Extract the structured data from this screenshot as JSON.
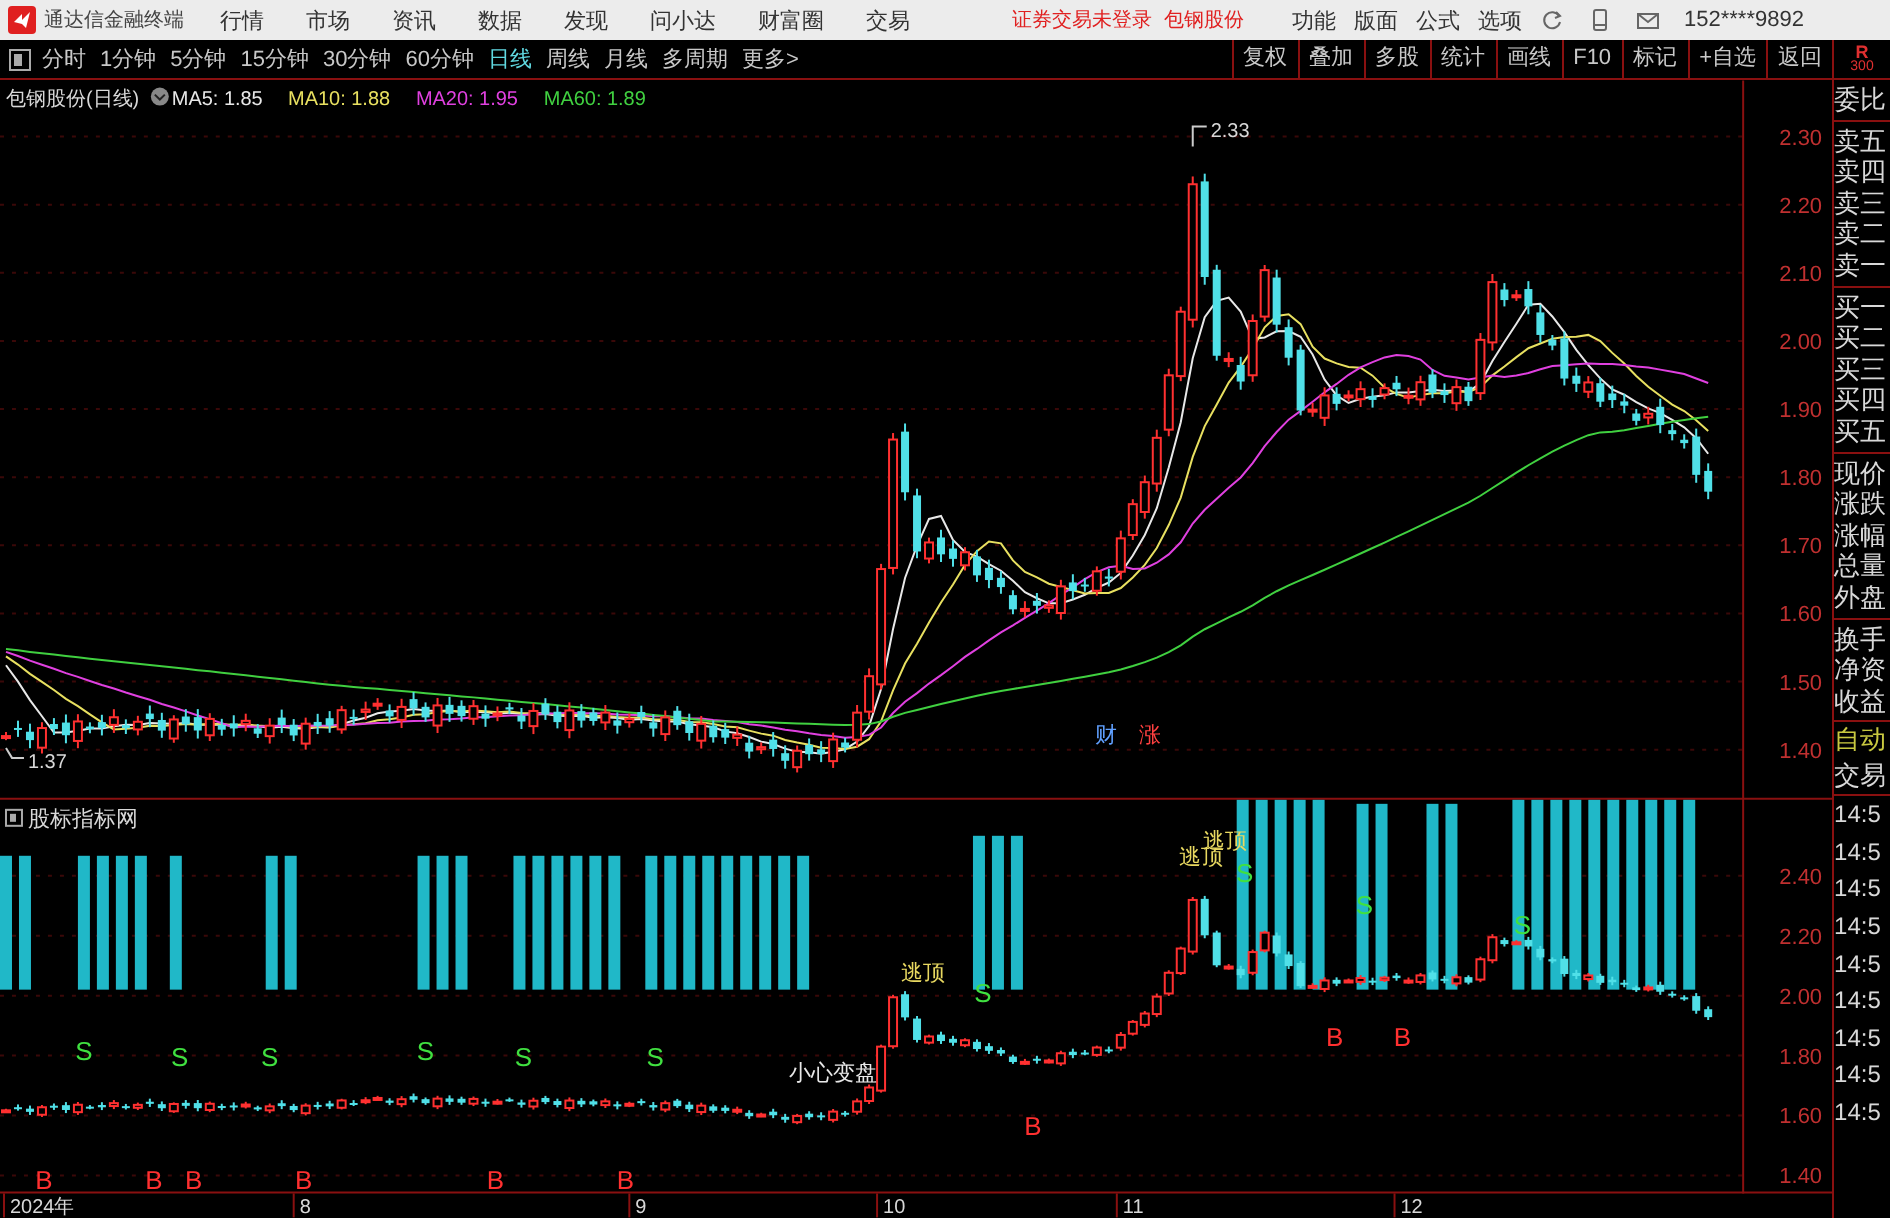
{
  "title_bar": {
    "app_name": "通达信金融终端",
    "menu": [
      "行情",
      "市场",
      "资讯",
      "数据",
      "发现",
      "问小达",
      "财富圈",
      "交易"
    ],
    "notice": "证券交易未登录",
    "stock": "包钢股份",
    "right_menu": [
      "功能",
      "版面",
      "公式",
      "选项"
    ],
    "account": "152****9892"
  },
  "period_tabs": [
    {
      "label": "分时",
      "selected": false
    },
    {
      "label": "1分钟",
      "selected": false
    },
    {
      "label": "5分钟",
      "selected": false
    },
    {
      "label": "15分钟",
      "selected": false
    },
    {
      "label": "30分钟",
      "selected": false
    },
    {
      "label": "60分钟",
      "selected": false
    },
    {
      "label": "日线",
      "selected": true
    },
    {
      "label": "周线",
      "selected": false
    },
    {
      "label": "月线",
      "selected": false
    },
    {
      "label": "多周期",
      "selected": false
    },
    {
      "label": "更多>",
      "selected": false
    }
  ],
  "tools": [
    "复权",
    "叠加",
    "多股",
    "统计",
    "画线",
    "F10",
    "标记",
    "+自选",
    "返回"
  ],
  "badge": {
    "letter": "R",
    "number": "300"
  },
  "price_chart": {
    "title": "包钢股份(日线)",
    "ma": [
      {
        "label": "MA5: 1.85",
        "color": "#e8e8e8"
      },
      {
        "label": "MA10: 1.88",
        "color": "#e8e060"
      },
      {
        "label": "MA20: 1.95",
        "color": "#e040e0"
      },
      {
        "label": "MA60: 1.89",
        "color": "#40d040"
      }
    ],
    "y_ticks": [
      "2.30",
      "2.20",
      "2.10",
      "2.00",
      "1.90",
      "1.80",
      "1.70",
      "1.60",
      "1.50",
      "1.40"
    ],
    "high_label": "2.33",
    "low_label": "1.37",
    "tags": [
      "财",
      "涨"
    ]
  },
  "indicator_chart": {
    "title": "股标指标网",
    "y_ticks": [
      "2.40",
      "2.20",
      "2.00",
      "1.80",
      "1.60",
      "1.40"
    ],
    "signals": [
      {
        "kind": "sell",
        "text": "S"
      },
      {
        "kind": "sell",
        "text": "S"
      },
      {
        "kind": "sell",
        "text": "S"
      },
      {
        "kind": "sell",
        "text": "S"
      },
      {
        "kind": "sell",
        "text": "S"
      },
      {
        "kind": "sell",
        "text": "S"
      },
      {
        "kind": "sell",
        "text": "S"
      },
      {
        "kind": "sell",
        "text": "S"
      },
      {
        "kind": "sell",
        "text": "S"
      },
      {
        "kind": "sell",
        "text": "S"
      },
      {
        "kind": "buy",
        "text": "B"
      },
      {
        "kind": "buy",
        "text": "B"
      },
      {
        "kind": "buy",
        "text": "B"
      },
      {
        "kind": "buy",
        "text": "B"
      },
      {
        "kind": "buy",
        "text": "B"
      },
      {
        "kind": "buy",
        "text": "B"
      },
      {
        "kind": "buy",
        "text": "B"
      },
      {
        "kind": "buy",
        "text": "B"
      },
      {
        "kind": "buy",
        "text": "B"
      },
      {
        "kind": "top",
        "text": "逃顶"
      },
      {
        "kind": "top",
        "text": "逃顶"
      },
      {
        "kind": "top",
        "text": "逃顶"
      },
      {
        "kind": "warn",
        "text": "小心变盘"
      }
    ]
  },
  "x_axis": [
    "2024年",
    "8",
    "9",
    "10",
    "11",
    "12"
  ],
  "sidebar": {
    "quote_groups": [
      [
        "委比"
      ],
      [
        "卖五",
        "卖四",
        "卖三",
        "卖二",
        "卖一"
      ],
      [
        "买一",
        "买二",
        "买三",
        "买四",
        "买五"
      ],
      [
        "现价",
        "涨跌",
        "涨幅",
        "总量",
        "外盘"
      ],
      [
        "换手",
        "净资",
        "收益"
      ]
    ],
    "auto": "自动",
    "trade": "交易",
    "times": [
      "14:5",
      "14:5",
      "14:5",
      "14:5",
      "14:5",
      "14:5",
      "14:5",
      "14:5",
      "14:5"
    ]
  }
}
